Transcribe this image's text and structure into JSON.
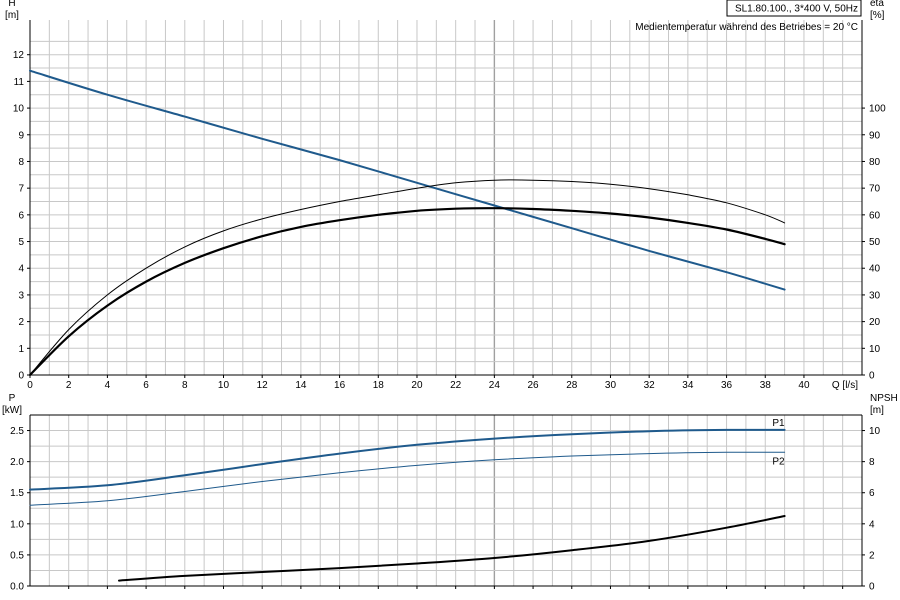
{
  "header": {
    "model": "SL1.80.100., 3*400 V, 50Hz",
    "note": "Medientemperatur während des Betriebes = 20 °C"
  },
  "colors": {
    "blue": "#1f5a8c",
    "black": "#000000",
    "grid": "#c8c8c8",
    "grid_major": "#a0a0a0"
  },
  "chart_data": [
    {
      "type": "line",
      "panel": "head-efficiency",
      "xlabel": "Q [l/s]",
      "ylabel_left": [
        "H",
        "[m]"
      ],
      "ylabel_right": [
        "eta",
        "[%]"
      ],
      "xlim": [
        0,
        43
      ],
      "ylim_left": [
        0,
        13.3
      ],
      "ylim_right": [
        0,
        133
      ],
      "x_ticks": [
        0,
        2,
        4,
        6,
        8,
        10,
        12,
        14,
        16,
        18,
        20,
        22,
        24,
        26,
        28,
        30,
        32,
        34,
        36,
        38,
        40
      ],
      "y_left_ticks": [
        0,
        1,
        2,
        3,
        4,
        5,
        6,
        7,
        8,
        9,
        10,
        11,
        12
      ],
      "y_right_ticks": [
        0,
        10,
        20,
        30,
        40,
        50,
        60,
        70,
        80,
        90,
        100
      ],
      "grid": true,
      "series": [
        {
          "id": "H",
          "axis": "left",
          "color": "#1f5a8c",
          "width": 2,
          "x": [
            0,
            4,
            8,
            12,
            16,
            20,
            24,
            28,
            32,
            36,
            39
          ],
          "y": [
            11.4,
            10.5,
            9.68,
            8.85,
            8.05,
            7.2,
            6.35,
            5.5,
            4.65,
            3.85,
            3.2
          ]
        },
        {
          "id": "eta-thick",
          "axis": "right",
          "color": "#000000",
          "width": 2.2,
          "x": [
            0,
            2,
            4,
            6,
            8,
            10,
            12,
            14,
            16,
            18,
            20,
            22,
            24,
            26,
            28,
            30,
            32,
            34,
            36,
            38,
            39
          ],
          "y": [
            0,
            14.5,
            26,
            35,
            42,
            47.5,
            52,
            55.5,
            58,
            60,
            61.5,
            62.3,
            62.5,
            62.2,
            61.5,
            60.5,
            59,
            57,
            54.5,
            51,
            49
          ]
        },
        {
          "id": "eta-thin",
          "axis": "right",
          "color": "#000000",
          "width": 1,
          "x": [
            0,
            2,
            4,
            6,
            8,
            10,
            12,
            14,
            16,
            18,
            20,
            22,
            24,
            26,
            28,
            30,
            32,
            34,
            36,
            38,
            39
          ],
          "y": [
            0,
            17,
            30,
            40,
            48,
            54,
            58.5,
            62,
            65,
            67.5,
            70,
            72,
            73,
            73,
            72.5,
            71.5,
            69.8,
            67.5,
            64.5,
            60,
            57
          ]
        }
      ]
    },
    {
      "type": "line",
      "panel": "power-npsh",
      "ylabel_left": [
        "P",
        "[kW]"
      ],
      "ylabel_right": [
        "NPSH",
        "[m]"
      ],
      "xlim": [
        0,
        43
      ],
      "ylim_left": [
        0,
        2.75
      ],
      "ylim_right": [
        0,
        11
      ],
      "y_left_ticks": [
        0.0,
        0.5,
        1.0,
        1.5,
        2.0,
        2.5
      ],
      "y_left_tick_labels": [
        "0.0",
        "0.5",
        "1.0",
        "1.5",
        "2.0",
        "2.5"
      ],
      "y_right_ticks": [
        0,
        2,
        4,
        6,
        8,
        10
      ],
      "grid": true,
      "series": [
        {
          "id": "P1",
          "name": "P1",
          "axis": "left",
          "color": "#1f5a8c",
          "width": 2,
          "x": [
            0,
            4,
            8,
            12,
            16,
            20,
            24,
            28,
            32,
            36,
            39
          ],
          "y": [
            1.55,
            1.62,
            1.78,
            1.96,
            2.13,
            2.27,
            2.37,
            2.44,
            2.49,
            2.51,
            2.51
          ]
        },
        {
          "id": "P2",
          "name": "P2",
          "axis": "left",
          "color": "#1f5a8c",
          "width": 1,
          "x": [
            0,
            4,
            8,
            12,
            16,
            20,
            24,
            28,
            32,
            36,
            39
          ],
          "y": [
            1.3,
            1.37,
            1.52,
            1.68,
            1.82,
            1.94,
            2.03,
            2.09,
            2.13,
            2.15,
            2.15
          ]
        },
        {
          "id": "NPSH",
          "axis": "right",
          "color": "#000000",
          "width": 2,
          "x": [
            4.6,
            8,
            12,
            16,
            20,
            24,
            28,
            32,
            36,
            39
          ],
          "y": [
            0.35,
            0.65,
            0.9,
            1.15,
            1.45,
            1.8,
            2.3,
            2.9,
            3.75,
            4.5
          ]
        }
      ]
    }
  ]
}
